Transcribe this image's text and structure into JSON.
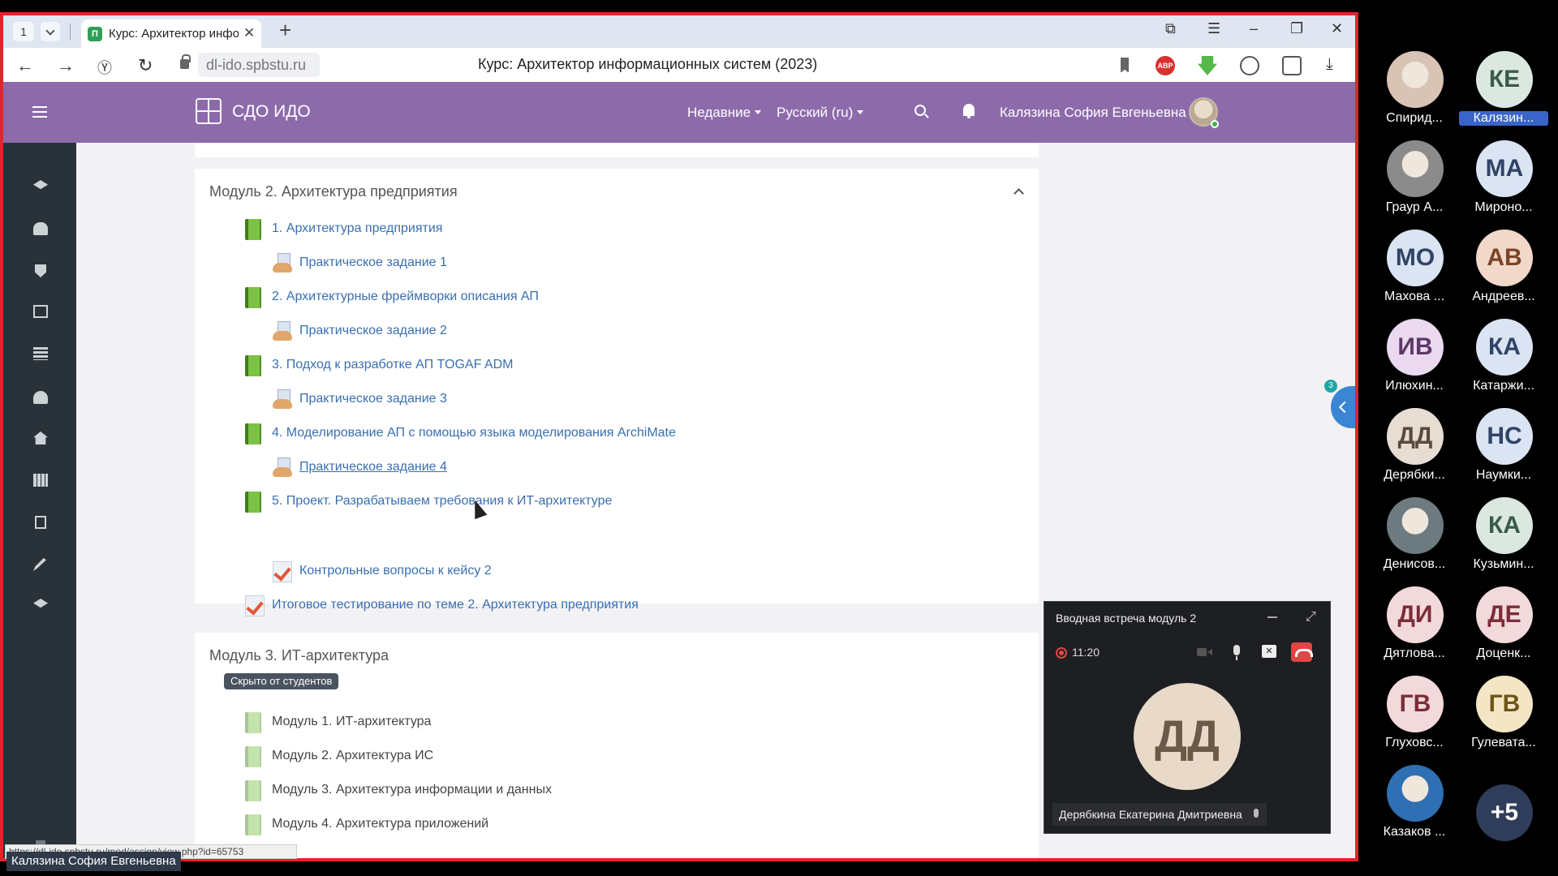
{
  "browser": {
    "tab_number": "1",
    "tab_favicon": "П",
    "tab_title": "Курс: Архитектор информационных систем",
    "url": "dl-ido.spbstu.ru",
    "page_title": "Курс: Архитектор информационных систем (2023)",
    "status_url": "https://dl-ido.spbstu.ru/mod/assign/view.php?id=65753"
  },
  "navbar": {
    "site_name": "СДО ИДО",
    "recent_label": "Недавние",
    "language_label": "Русский (ru)",
    "user_name": "Калязина София Евгеньевна"
  },
  "module2": {
    "title": "Модуль 2. Архитектура предприятия",
    "activities": [
      {
        "type": "book",
        "label": "1. Архитектура предприятия"
      },
      {
        "type": "assign",
        "label": "Практическое задание 1"
      },
      {
        "type": "book",
        "label": "2. Архитектурные фреймворки описания АП"
      },
      {
        "type": "assign",
        "label": "Практическое задание 2"
      },
      {
        "type": "book",
        "label": "3. Подход к разработке АП TOGAF ADM"
      },
      {
        "type": "assign",
        "label": "Практическое задание 3"
      },
      {
        "type": "book",
        "label": "4. Моделирование АП с помощью языка моделирования ArchiMate"
      },
      {
        "type": "assign",
        "label": "Практическое задание 4"
      },
      {
        "type": "book",
        "label": "5. Проект. Разрабатываем требования к ИТ-архитектуре"
      },
      {
        "type": "quiz",
        "label": "Контрольные вопросы к кейсу 2"
      },
      {
        "type": "quiz",
        "label": "Итоговое тестирование по теме 2. Архитектура предприятия"
      }
    ]
  },
  "module3": {
    "title": "Модуль 3. ИТ-архитектура",
    "badge": "Скрыто от студентов",
    "activities": [
      {
        "type": "book",
        "label": "Модуль 1. ИТ-архитектура"
      },
      {
        "type": "book",
        "label": "Модуль 2. Архитектура ИС"
      },
      {
        "type": "book",
        "label": "Модуль 3. Архитектура информации и данных"
      },
      {
        "type": "book",
        "label": "Модуль 4. Архитектура приложений"
      }
    ]
  },
  "drawer_badge": "3",
  "presenter_label": "Калязина София Евгеньевна",
  "call": {
    "title": "Вводная встреча модуль 2",
    "record_time": "11:20",
    "speaker_initials": "ДД",
    "speaker_name": "Дерябкина Екатерина Дмитриевна"
  },
  "participants": [
    {
      "initials": "",
      "name": "Спирид...",
      "photo": true,
      "color": "#d8c3b4"
    },
    {
      "initials": "КЕ",
      "name": "Калязин...",
      "color": "#dbe8e0",
      "text": "#3b5b4a",
      "highlight": true
    },
    {
      "initials": "",
      "name": "Граур А...",
      "photo": true,
      "color": "#8b8b8b"
    },
    {
      "initials": "МА",
      "name": "Мироно...",
      "color": "#dbe4f2",
      "text": "#2f4467"
    },
    {
      "initials": "МО",
      "name": "Махова ...",
      "color": "#dbe4f2",
      "text": "#2f4467"
    },
    {
      "initials": "АВ",
      "name": "Андреев...",
      "color": "#f2d8c9",
      "text": "#7a4526"
    },
    {
      "initials": "ИВ",
      "name": "Илюхин...",
      "color": "#ead9ef",
      "text": "#5e3868"
    },
    {
      "initials": "КА",
      "name": "Катаржи...",
      "color": "#dbe4f2",
      "text": "#2f4467"
    },
    {
      "initials": "ДД",
      "name": "Дерябки...",
      "color": "#e8ddd3",
      "text": "#5a4a3c"
    },
    {
      "initials": "НС",
      "name": "Наумки...",
      "color": "#dbe4f2",
      "text": "#2f4467"
    },
    {
      "initials": "",
      "name": "Денисов...",
      "photo": true,
      "color": "#6d7a80"
    },
    {
      "initials": "КА",
      "name": "Кузьмин...",
      "color": "#dbe8e0",
      "text": "#3b5b4a"
    },
    {
      "initials": "ДИ",
      "name": "Дятлова...",
      "color": "#f2d9dc",
      "text": "#7a2d38"
    },
    {
      "initials": "ДЕ",
      "name": "Доценк...",
      "color": "#f2d9dc",
      "text": "#7a2d38"
    },
    {
      "initials": "ГВ",
      "name": "Глуховс...",
      "color": "#f2d9dc",
      "text": "#7a2d38"
    },
    {
      "initials": "ГВ",
      "name": "Гулевата...",
      "color": "#f4e6c4",
      "text": "#6f5418"
    },
    {
      "initials": "",
      "name": "Казаков ...",
      "photo": true,
      "color": "#2f6fb3"
    },
    {
      "initials": "+5",
      "name": "",
      "color": "#2f3d5a",
      "text": "#ffffff"
    }
  ],
  "colors": {
    "navbar": "#8d6bab",
    "drawer": "#2a3239",
    "link": "#3a6fb0",
    "share_border": "#e3242b"
  }
}
